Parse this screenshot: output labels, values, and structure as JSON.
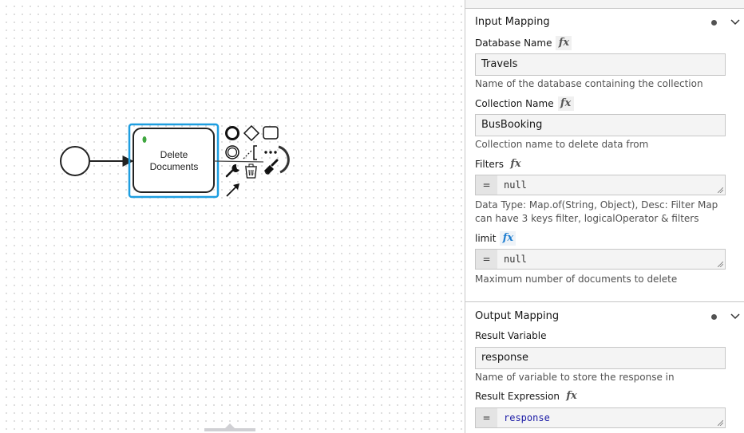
{
  "canvas": {
    "task": {
      "label_line1": "Delete",
      "label_line2": "Documents"
    },
    "context_pad": {
      "items": [
        "end-event",
        "gateway",
        "task",
        "intermediate-event",
        "text-annotation",
        "more",
        "change-type",
        "delete",
        "color",
        "connect"
      ]
    },
    "colors": {
      "selection": "#1e9ee0",
      "marker": "#3fa63f"
    }
  },
  "panel": {
    "input_mapping": {
      "title": "Input Mapping",
      "fields": {
        "database_name": {
          "label": "Database Name",
          "fx": "fx",
          "value": "Travels",
          "description": "Name of the database containing the collection"
        },
        "collection_name": {
          "label": "Collection Name",
          "fx": "fx",
          "value": "BusBooking",
          "description": "Collection name to delete data from"
        },
        "filters": {
          "label": "Filters",
          "fx": "fx",
          "eq": "=",
          "value": "null",
          "description_line1": "Data Type: Map.of(String, Object), Desc: Filter Map",
          "description_line2": "can have 3 keys filter, logicalOperator & filters"
        },
        "limit": {
          "label": "limit",
          "fx": "fx",
          "eq": "=",
          "value": "null",
          "description": "Maximum number of documents to delete"
        }
      }
    },
    "output_mapping": {
      "title": "Output Mapping",
      "fields": {
        "result_variable": {
          "label": "Result Variable",
          "value": "response",
          "description": "Name of variable to store the response in"
        },
        "result_expression": {
          "label": "Result Expression",
          "fx": "fx",
          "eq": "=",
          "value": "response"
        }
      }
    }
  }
}
